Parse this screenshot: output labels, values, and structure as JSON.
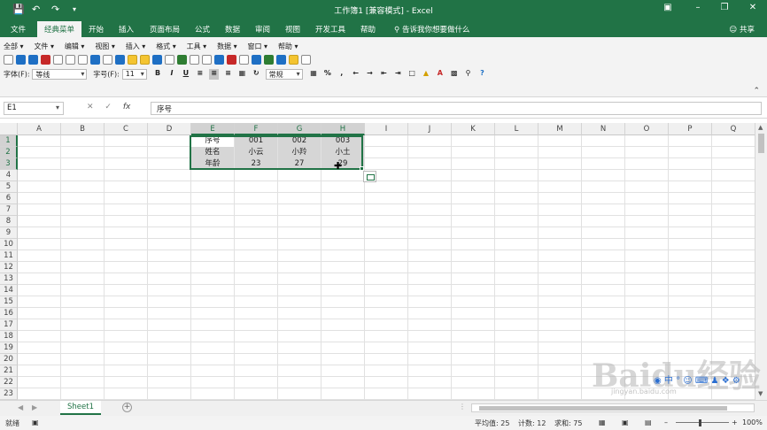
{
  "window": {
    "title": "工作簿1 [兼容模式] - Excel",
    "quick_access": [
      "save",
      "undo",
      "redo",
      "customize"
    ],
    "controls": [
      "ribbon-display",
      "minimize",
      "restore",
      "close"
    ]
  },
  "ribbon_tabs": [
    "文件",
    "经典菜单",
    "开始",
    "插入",
    "页面布局",
    "公式",
    "数据",
    "审阅",
    "视图",
    "开发工具",
    "帮助"
  ],
  "active_tab": "经典菜单",
  "tell_me": "告诉我你想要做什么",
  "share_label": "共享",
  "classic_menu": [
    "全部 ▾",
    "文件 ▾",
    "编辑 ▾",
    "视图 ▾",
    "插入 ▾",
    "格式 ▾",
    "工具 ▾",
    "数据 ▾",
    "窗口 ▾",
    "帮助 ▾"
  ],
  "format_bar": {
    "font_label": "字体(F):",
    "font_value": "等线",
    "size_label": "字号(F):",
    "size_value": "11",
    "bold": "B",
    "italic": "I",
    "underline": "U",
    "number_format": "常规",
    "percent": "%"
  },
  "formula_bar": {
    "name_box": "E1",
    "fx": "fx",
    "content": "序号"
  },
  "columns": [
    "A",
    "B",
    "C",
    "D",
    "E",
    "F",
    "G",
    "H",
    "I",
    "J",
    "K",
    "L",
    "M",
    "N",
    "O",
    "P",
    "Q"
  ],
  "rows": [
    "1",
    "2",
    "3",
    "4",
    "5",
    "6",
    "7",
    "8",
    "9",
    "10",
    "11",
    "12",
    "13",
    "14",
    "15",
    "16",
    "17",
    "18",
    "19",
    "20",
    "21",
    "22",
    "23"
  ],
  "cells": {
    "E1": "序号",
    "F1": "001",
    "G1": "002",
    "H1": "003",
    "E2": "姓名",
    "F2": "小云",
    "G2": "小羚",
    "H2": "小土",
    "E3": "年龄",
    "F3": "23",
    "G3": "27",
    "H3": "29"
  },
  "sheet_tab": "Sheet1",
  "status": {
    "mode": "就绪",
    "average": "平均值: 25",
    "count": "计数: 12",
    "sum": "求和: 75",
    "zoom": "100%"
  },
  "overlay": {
    "ime_text": "中",
    "watermark": "Baidu经验",
    "watermark_url": "jingyan.baidu.com"
  }
}
